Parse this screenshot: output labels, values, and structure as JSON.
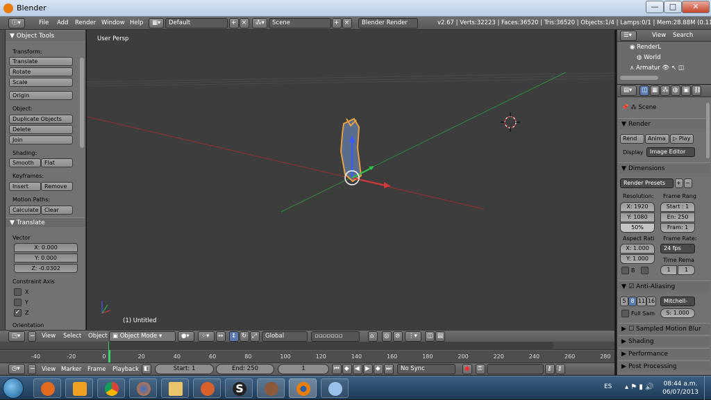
{
  "window": {
    "title": "Blender",
    "min_glyph": "—",
    "max_glyph": "□",
    "close_glyph": "✕"
  },
  "infobar": {
    "menus": [
      "File",
      "Add",
      "Render",
      "Window",
      "Help"
    ],
    "layout": "Default",
    "scene": "Scene",
    "engine": "Blender Render",
    "stats": "v2.67 | Verts:32223 | Faces:36520 | Tris:36520 | Objects:1/4 | Lamps:0/1 | Mem:28.88M (0.11M) | Ar"
  },
  "toolshelf": {
    "title": "Object Tools",
    "transform_label": "Transform:",
    "translate": "Translate",
    "rotate": "Rotate",
    "scale": "Scale",
    "origin": "Origin",
    "object_label": "Object:",
    "duplicate": "Duplicate Objects",
    "delete": "Delete",
    "join": "Join",
    "shading_label": "Shading:",
    "smooth": "Smooth",
    "flat": "Flat",
    "keyframes_label": "Keyframes:",
    "insert": "Insert",
    "remove": "Remove",
    "motion_label": "Motion Paths:",
    "calculate": "Calculate",
    "clear": "Clear",
    "op_title": "Translate",
    "vector_label": "Vector",
    "x": "X: 0.000",
    "y": "Y: 0.000",
    "z": "Z: -0.0302",
    "constraint_label": "Constraint Axis",
    "cx": "X",
    "cy": "Y",
    "cz": "Z",
    "orientation_label": "Orientation"
  },
  "viewport": {
    "label": "User Persp",
    "object": "(1) Untitled"
  },
  "view_header": {
    "menus": [
      "View",
      "Select",
      "Object"
    ],
    "mode": "Object Mode",
    "orientation": "Global"
  },
  "timeline": {
    "ticks": [
      "-40",
      "-20",
      "0",
      "20",
      "40",
      "60",
      "80",
      "100",
      "120",
      "140",
      "160",
      "180",
      "200",
      "220",
      "240",
      "260",
      "280"
    ],
    "menus": [
      "View",
      "Marker",
      "Frame",
      "Playback"
    ],
    "start": "Start: 1",
    "end": "End: 250",
    "current": "1",
    "sync": "No Sync"
  },
  "outliner": {
    "menus": [
      "View",
      "Search"
    ],
    "items": [
      "RenderL",
      "World",
      "Armatur"
    ]
  },
  "properties": {
    "scene_crumb": "Scene",
    "render_panel": "Render",
    "render_btn": "Rend",
    "anim_btn": "Anima",
    "play_btn": "Play",
    "display_label": "Display",
    "display_value": "Image Editor",
    "dimensions_panel": "Dimensions",
    "presets": "Render Presets",
    "resolution_label": "Resolution:",
    "frame_range_label": "Frame Rang",
    "res_x": "X: 1920",
    "res_y": "Y: 1080",
    "res_pct": "50%",
    "start": "Start : 1",
    "end": "En: 250",
    "frame": "Fram: 1",
    "aspect_label": "Aspect Rati",
    "frame_rate_label": "Frame Rate:",
    "aspect_x": "X: 1.000",
    "aspect_y": "Y: 1.000",
    "fps": "24 fps",
    "time_remap_label": "Time Rema",
    "border_label": "B",
    "remap_old": "1",
    "remap_new": "1",
    "aa_panel": "Anti-Aliasing",
    "aa_5": "5",
    "aa_8": "8",
    "aa_11": "11",
    "aa_16": "16",
    "aa_filter": "Mitchell-",
    "full_sample": "Full Sam",
    "aa_size": "S: 1.000",
    "smb_panel": "Sampled Motion Blur",
    "shading_panel": "Shading",
    "performance_panel": "Performance",
    "post_panel": "Post Processing"
  },
  "taskbar": {
    "lang": "ES",
    "time": "08:44 a.m.",
    "date": "06/07/2013",
    "apps": [
      "media-player",
      "chrome",
      "firefox",
      "explorer",
      "pixlr",
      "slider",
      "creature",
      "blender",
      "paint"
    ]
  },
  "colors": {
    "x_axis": "#c0392b",
    "y_axis": "#2fa84f",
    "accent": "#e87d0d",
    "viewport_bg": "#3d3d3d"
  }
}
